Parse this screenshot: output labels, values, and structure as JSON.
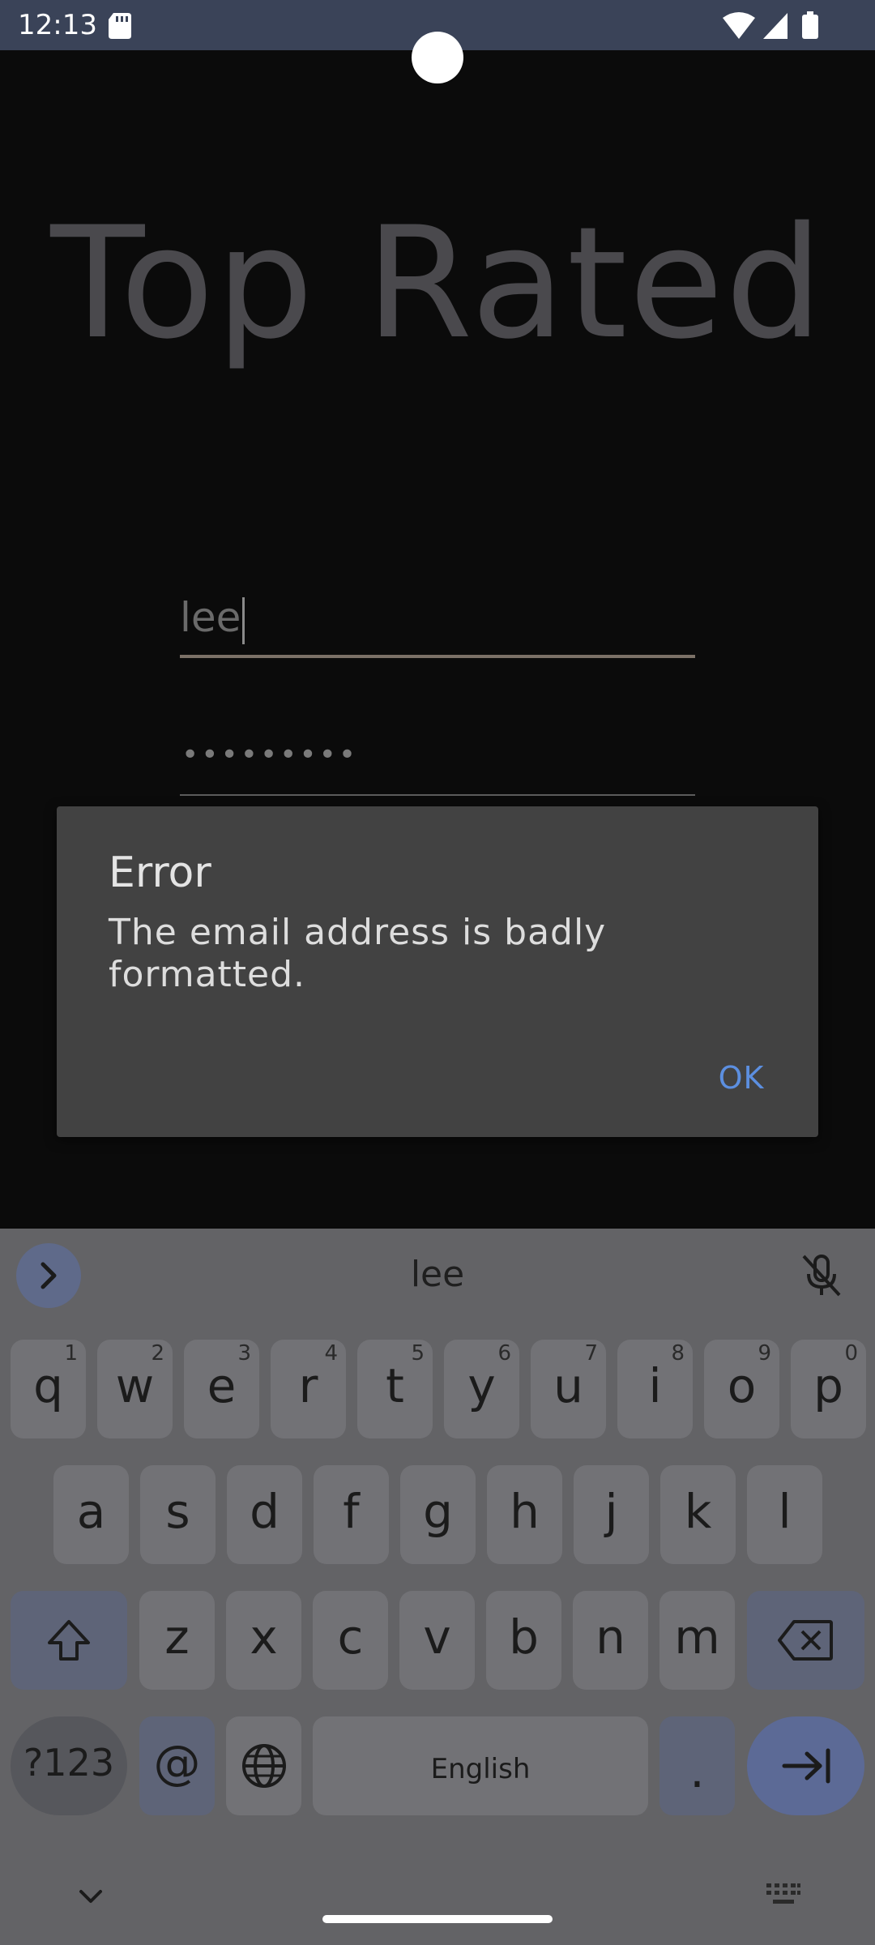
{
  "status_bar": {
    "time": "12:13"
  },
  "app": {
    "title": "Top Rated",
    "email_value": "lee",
    "password_mask": "•••••••••"
  },
  "dialog": {
    "title": "Error",
    "message": "The email address is badly formatted.",
    "ok_label": "OK"
  },
  "keyboard": {
    "suggestion": "lee",
    "row1": [
      {
        "k": "q",
        "h": "1"
      },
      {
        "k": "w",
        "h": "2"
      },
      {
        "k": "e",
        "h": "3"
      },
      {
        "k": "r",
        "h": "4"
      },
      {
        "k": "t",
        "h": "5"
      },
      {
        "k": "y",
        "h": "6"
      },
      {
        "k": "u",
        "h": "7"
      },
      {
        "k": "i",
        "h": "8"
      },
      {
        "k": "o",
        "h": "9"
      },
      {
        "k": "p",
        "h": "0"
      }
    ],
    "row2": [
      "a",
      "s",
      "d",
      "f",
      "g",
      "h",
      "j",
      "k",
      "l"
    ],
    "row3": [
      "z",
      "x",
      "c",
      "v",
      "b",
      "n",
      "m"
    ],
    "sym_label": "?123",
    "at_label": "@",
    "space_label": "English",
    "period_label": "."
  },
  "colors": {
    "status_bar": "#3a4358",
    "dialog_bg": "#424242",
    "accent": "#5c8fe0",
    "keyboard_bg": "#636366"
  }
}
